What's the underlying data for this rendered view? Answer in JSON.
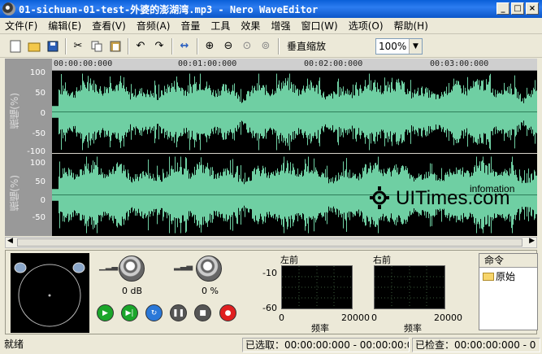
{
  "window": {
    "title": "01-sichuan-01-test-外婆的澎湖湾.mp3 - Nero WaveEditor"
  },
  "menu": [
    "文件(F)",
    "编辑(E)",
    "查看(V)",
    "音频(A)",
    "音量",
    "工具",
    "效果",
    "增强",
    "窗口(W)",
    "选项(O)",
    "帮助(H)"
  ],
  "toolbar": {
    "zoom_label": "垂直缩放",
    "zoom_value": "100%"
  },
  "timeline": [
    "00:00:00:000",
    "00:01:00:000",
    "00:02:00:000",
    "00:03:00:000"
  ],
  "yaxis": {
    "ticks": [
      "100",
      "50",
      "0",
      "-50",
      "-100"
    ],
    "title": "振幅(%)"
  },
  "controls": {
    "volume_value": "0 dB",
    "pan_value": "0 %"
  },
  "meters": {
    "left_label": "左前",
    "right_label": "右前",
    "db_top": "-10",
    "db_bottom": "-60",
    "freq_min": "0",
    "freq_max": "20000",
    "freq_label": "频率"
  },
  "commands": {
    "header": "命令",
    "items": [
      "原始"
    ]
  },
  "status": {
    "state": "就绪",
    "selected": "已选取：00:00:00:000 - 00:00:00:00",
    "checked": "已检查：00:00:00:000 - 0"
  },
  "watermark": {
    "brand": "UITimes.com",
    "tag": "infomation"
  },
  "colors": {
    "wave": "#6fcfa3",
    "title_bar": "#0a5fd8",
    "background": "#ece9d8"
  }
}
